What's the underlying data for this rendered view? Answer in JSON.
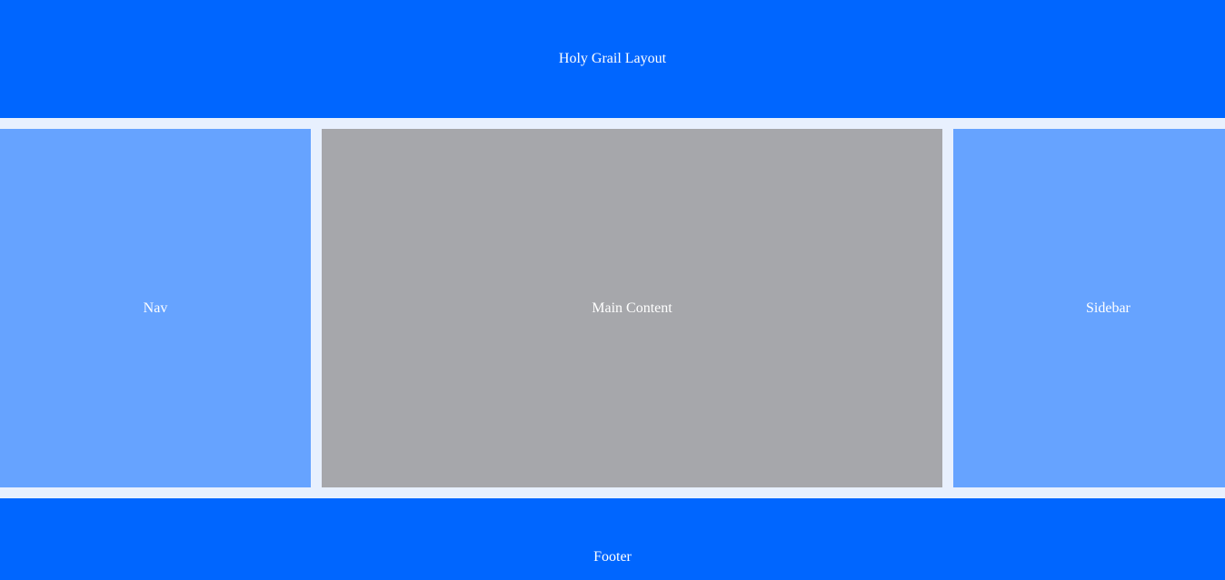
{
  "header": {
    "title": "Holy Grail Layout"
  },
  "nav": {
    "label": "Nav"
  },
  "main": {
    "label": "Main Content"
  },
  "sidebar": {
    "label": "Sidebar"
  },
  "footer": {
    "label": "Footer"
  },
  "colors": {
    "header_footer": "#0066ff",
    "side_panels": "#66a3ff",
    "main_panel": "#a6a7ab",
    "gutter": "#e8f0fe",
    "text": "#ffffff"
  }
}
